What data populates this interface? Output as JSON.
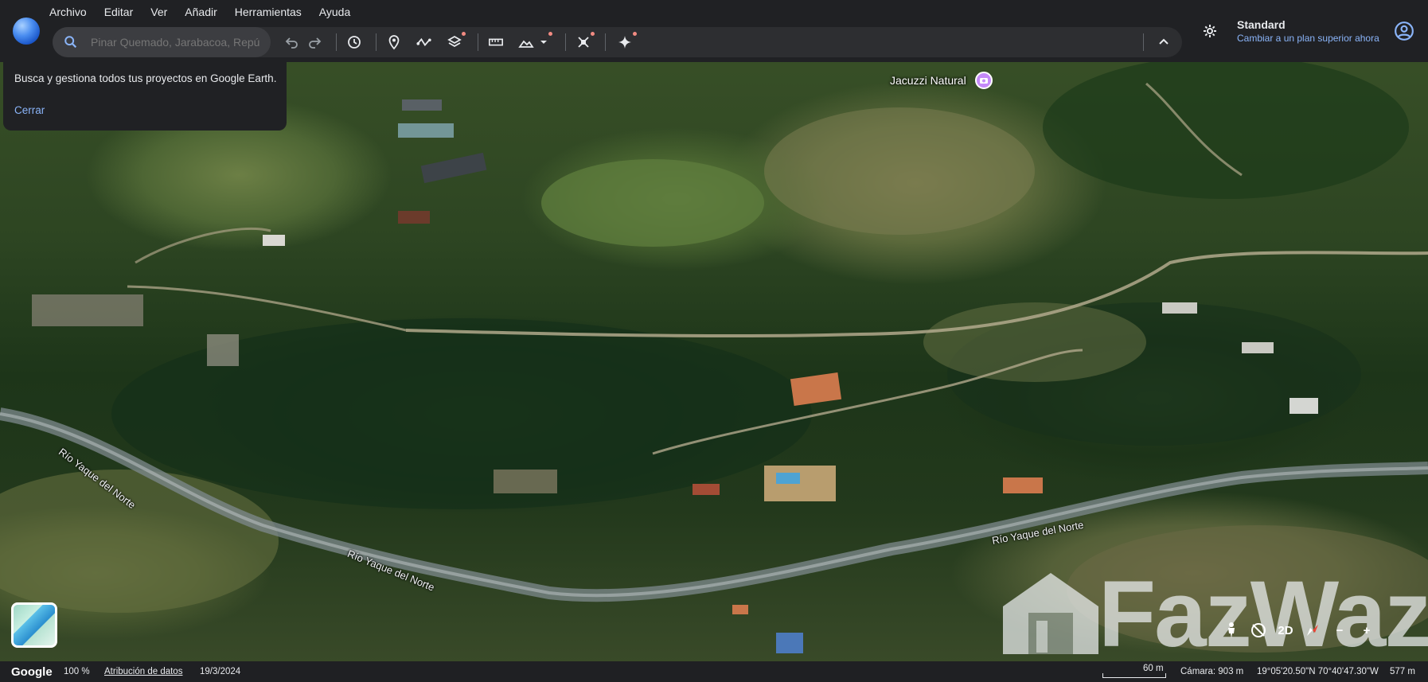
{
  "menu": [
    "Archivo",
    "Editar",
    "Ver",
    "Añadir",
    "Herramientas",
    "Ayuda"
  ],
  "search": {
    "placeholder": "Pinar Quemado, Jarabacoa, Repú"
  },
  "toolbar": {
    "icons": [
      "undo-icon",
      "redo-icon",
      "history-icon",
      "placemark-icon",
      "path-icon",
      "layers-icon",
      "ruler-icon",
      "image-overlay-icon",
      "satellite-tools-icon",
      "gemini-sparkle-icon",
      "collapse-icon"
    ]
  },
  "account": {
    "plan_title": "Standard",
    "plan_link": "Cambiar a un plan superior ahora"
  },
  "popover": {
    "text": "Busca y gestiona todos tus proyectos en Google Earth.",
    "close": "Cerrar"
  },
  "map": {
    "poi_label": "Jacuzzi Natural",
    "river_labels": [
      "Río Yaque del Norte",
      "Río Yaque del Norte",
      "Río Yaque del Norte"
    ]
  },
  "watermark": {
    "text": "FazWaz"
  },
  "controls": {
    "view_2d": "2D",
    "zoom_out": "−",
    "zoom_in": "+"
  },
  "status": {
    "logo": "Google",
    "zoom": "100 %",
    "attribution": "Atribución de datos",
    "date": "19/3/2024",
    "scale": "60 m",
    "camera": "Cámara: 903 m",
    "coords": "19°05'20.50\"N 70°40'47.30\"W",
    "elevation": "577 m"
  },
  "colors": {
    "accent": "#8ab4f8",
    "chrome": "#202124",
    "toolbar": "#2d2e31",
    "poi": "#c58af9"
  }
}
